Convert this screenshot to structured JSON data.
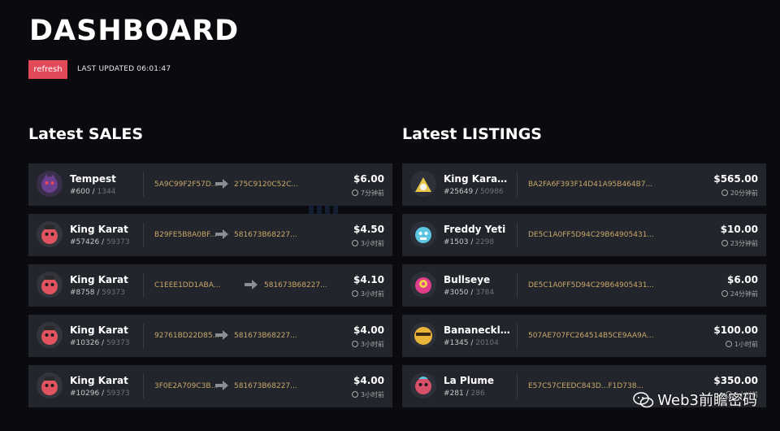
{
  "header": {
    "title": "DASHBOARD",
    "refresh_label": "refresh",
    "last_updated": "LAST UPDATED 06:01:47"
  },
  "sales": {
    "title": "Latest SALES",
    "items": [
      {
        "name": "Tempest",
        "id": "#600",
        "total": "1344",
        "from": "5A9C99F2F57D...",
        "to": "275C9120C52C...",
        "price": "$6.00",
        "time": "7分钟前",
        "avatar_color": "#6a3f8f"
      },
      {
        "name": "King Karat",
        "id": "#57426",
        "total": "59373",
        "from": "B29FE5B8A0BF...",
        "to": "581673B68227...",
        "price": "$4.50",
        "time": "3小时前",
        "avatar_color": "#e0535f"
      },
      {
        "name": "King Karat",
        "id": "#8758",
        "total": "59373",
        "from": "C1EEE1DD1ABA...",
        "to": "581673B68227...",
        "price": "$4.10",
        "time": "3小时前",
        "avatar_color": "#e0535f"
      },
      {
        "name": "King Karat",
        "id": "#10326",
        "total": "59373",
        "from": "92761BD22D85...",
        "to": "581673B68227...",
        "price": "$4.00",
        "time": "3小时前",
        "avatar_color": "#e0535f"
      },
      {
        "name": "King Karat",
        "id": "#10296",
        "total": "59373",
        "from": "3F0E2A709C3B...",
        "to": "581673B68227...",
        "price": "$4.00",
        "time": "3小时前",
        "avatar_color": "#e0535f"
      }
    ]
  },
  "listings": {
    "title": "Latest LISTINGS",
    "items": [
      {
        "name": "King Karat B...",
        "id": "#25649",
        "total": "50986",
        "addr": "BA2FA6F393F14D41A95B464B7...",
        "price": "$565.00",
        "time": "20分钟前",
        "avatar_color": "#e8c64a"
      },
      {
        "name": "Freddy Yeti",
        "id": "#1503",
        "total": "2298",
        "addr": "DE5C1A0FF5D94C29B64905431...",
        "price": "$10.00",
        "time": "23分钟前",
        "avatar_color": "#5cc6e0"
      },
      {
        "name": "Bullseye",
        "id": "#3050",
        "total": "3784",
        "addr": "DE5C1A0FF5D94C29B64905431...",
        "price": "$6.00",
        "time": "24分钟前",
        "avatar_color": "#e03e8c"
      },
      {
        "name": "Bananecklace",
        "id": "#1345",
        "total": "20104",
        "addr": "507AE707FC264514B5CE9AA9A...",
        "price": "$100.00",
        "time": "1小时前",
        "avatar_color": "#e8b43a"
      },
      {
        "name": "La Plume",
        "id": "#281",
        "total": "286",
        "addr": "E57C57CEEDC843D...F1D738...",
        "price": "$350.00",
        "time": "5小时前",
        "avatar_color": "#d9506a"
      }
    ]
  },
  "watermark": "Web3前瞻密码"
}
